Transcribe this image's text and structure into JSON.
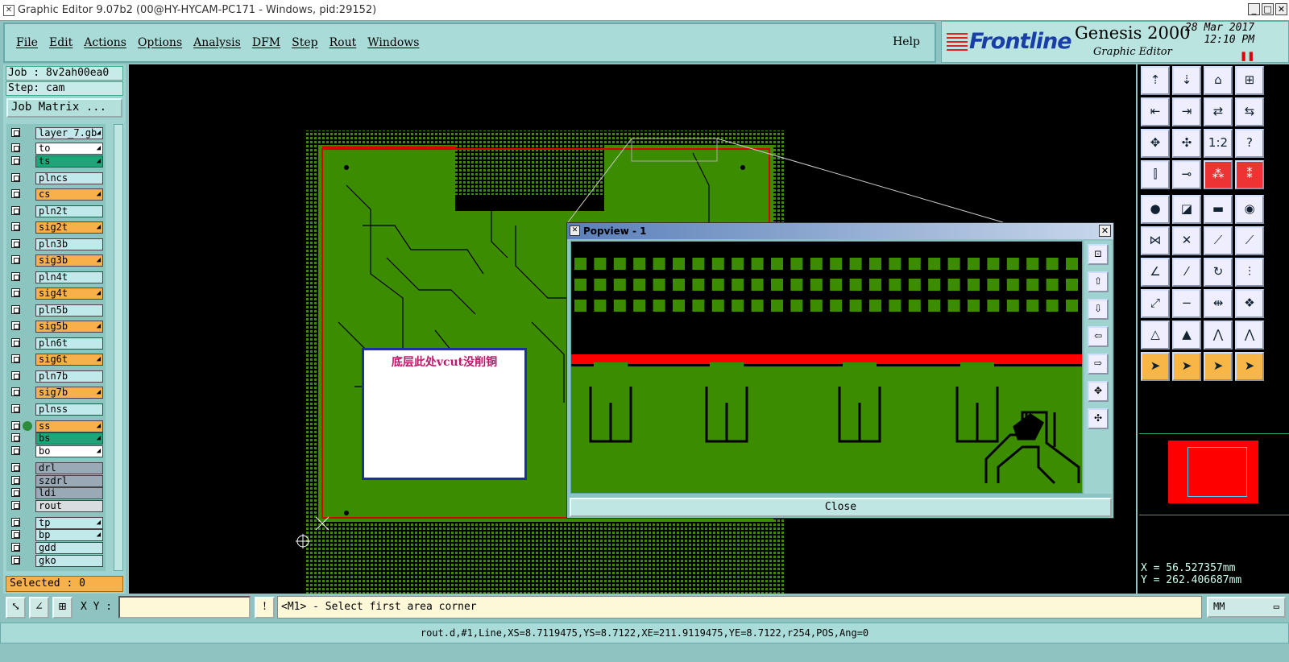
{
  "window": {
    "title": "Graphic Editor 9.07b2 (00@HY-HYCAM-PC171 - Windows, pid:29152)",
    "icon": "app-window-icon"
  },
  "menu": {
    "items": [
      "File",
      "Edit",
      "Actions",
      "Options",
      "Analysis",
      "DFM",
      "Step",
      "Rout",
      "Windows"
    ],
    "help": "Help"
  },
  "brand": {
    "logo": "Frontline",
    "product": "Genesis 2000",
    "subtitle": "Graphic Editor",
    "date": "28 Mar 2017",
    "time": "12:10 PM"
  },
  "left": {
    "job": "Job : 8v2ah00ea0",
    "step": "Step: cam",
    "job_matrix": "Job Matrix ...",
    "layers": [
      {
        "name": "layer_7.gb",
        "color": "#bfe9ea",
        "arrow": true
      },
      {
        "name": "to",
        "color": "#ffffff",
        "arrow": true
      },
      {
        "name": "ts",
        "color": "#1fa57a",
        "arrow": true
      },
      {
        "name": "plncs",
        "color": "#bfe9ea",
        "arrow": false
      },
      {
        "name": "cs",
        "color": "#f8b04b",
        "arrow": true
      },
      {
        "name": "pln2t",
        "color": "#bfe9ea",
        "arrow": false
      },
      {
        "name": "sig2t",
        "color": "#f8b04b",
        "arrow": true
      },
      {
        "name": "pln3b",
        "color": "#bfe9ea",
        "arrow": false
      },
      {
        "name": "sig3b",
        "color": "#f8b04b",
        "arrow": true
      },
      {
        "name": "pln4t",
        "color": "#bfe9ea",
        "arrow": false
      },
      {
        "name": "sig4t",
        "color": "#f8b04b",
        "arrow": true
      },
      {
        "name": "pln5b",
        "color": "#bfe9ea",
        "arrow": false
      },
      {
        "name": "sig5b",
        "color": "#f8b04b",
        "arrow": true
      },
      {
        "name": "pln6t",
        "color": "#bfe9ea",
        "arrow": false
      },
      {
        "name": "sig6t",
        "color": "#f8b04b",
        "arrow": true
      },
      {
        "name": "pln7b",
        "color": "#bfe9ea",
        "arrow": false
      },
      {
        "name": "sig7b",
        "color": "#f8b04b",
        "arrow": true
      },
      {
        "name": "plnss",
        "color": "#bfe9ea",
        "arrow": false
      },
      {
        "name": "ss",
        "color": "#f8b04b",
        "arrow": true
      },
      {
        "name": "bs",
        "color": "#1fa57a",
        "arrow": true
      },
      {
        "name": "bo",
        "color": "#ffffff",
        "arrow": true
      },
      {
        "name": "drl",
        "color": "#9aa9b6",
        "arrow": false
      },
      {
        "name": "szdrl",
        "color": "#9aa9b6",
        "arrow": false
      },
      {
        "name": "ldi",
        "color": "#9aa9b6",
        "arrow": false
      },
      {
        "name": "rout",
        "color": "#d8dde0",
        "arrow": false
      },
      {
        "name": "tp",
        "color": "#bfe9ea",
        "arrow": true
      },
      {
        "name": "bp",
        "color": "#bfe9ea",
        "arrow": true
      },
      {
        "name": "gdd",
        "color": "#bfe9ea",
        "arrow": false
      },
      {
        "name": "gko",
        "color": "#bfe9ea",
        "arrow": false
      }
    ],
    "selected": "Selected : 0"
  },
  "canvas": {
    "note": "底层此处vcut没削铜",
    "board_color": "#3c8c00",
    "outline_color": "#d00000"
  },
  "popup": {
    "title": "Popview - 1",
    "close_label": "Close"
  },
  "coords": {
    "x": "X =  56.527357mm",
    "y": "Y = 262.406687mm"
  },
  "bottom": {
    "xy_label": "X Y :",
    "xy_value": "",
    "prompt": "<M1> - Select first area corner",
    "unit": "MM"
  },
  "status": "rout.d,#1,Line,XS=8.7119475,YS=8.7122,XE=211.9119475,YE=8.7122,r254,POS,Ang=0"
}
